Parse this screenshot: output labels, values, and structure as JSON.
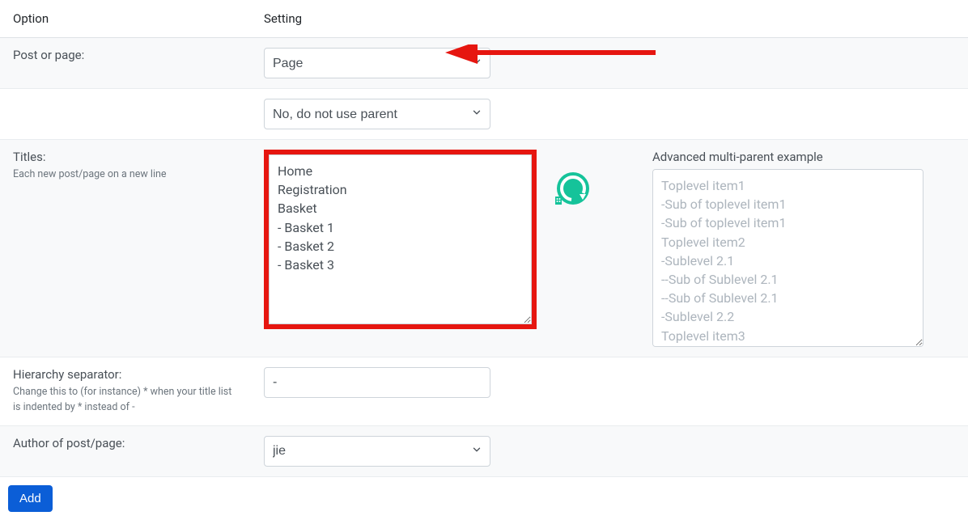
{
  "headers": {
    "option": "Option",
    "setting": "Setting"
  },
  "rows": {
    "post_or_page": {
      "label": "Post or page:",
      "value": "Page"
    },
    "parent": {
      "value": "No, do not use parent"
    },
    "titles": {
      "label": "Titles:",
      "help": "Each new post/page on a new line",
      "value": "Home\nRegistration\nBasket\n- Basket 1\n- Basket 2\n- Basket 3",
      "example_header": "Advanced multi-parent example",
      "example_text": "Toplevel item1\n-Sub of toplevel item1\n-Sub of toplevel item1\nToplevel item2\n-Sublevel 2.1\n--Sub of Sublevel 2.1\n--Sub of Sublevel 2.1\n-Sublevel 2.2\nToplevel item3"
    },
    "hierarchy": {
      "label": "Hierarchy separator:",
      "help": "Change this to (for instance) * when your title list is indented by * instead of -",
      "value": "-"
    },
    "author": {
      "label": "Author of post/page:",
      "value": "jie"
    }
  },
  "buttons": {
    "add": "Add"
  },
  "icons": {
    "grammarly_letter": "G"
  },
  "colors": {
    "highlight": "#e61610",
    "arrow": "#e61610",
    "primary": "#0b5ed7"
  }
}
